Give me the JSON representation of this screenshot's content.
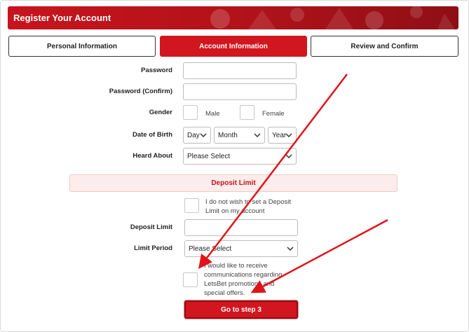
{
  "header": {
    "title": "Register Your Account"
  },
  "steps": [
    {
      "label": "Personal Information",
      "active": false
    },
    {
      "label": "Account Information",
      "active": true
    },
    {
      "label": "Review and Confirm",
      "active": false
    }
  ],
  "form": {
    "password_label": "Password",
    "password_confirm_label": "Password (Confirm)",
    "gender_label": "Gender",
    "gender_male": "Male",
    "gender_female": "Female",
    "dob_label": "Date of Birth",
    "dob_day": "Day",
    "dob_month": "Month",
    "dob_year": "Year",
    "heard_about_label": "Heard About",
    "heard_about_value": "Please Select"
  },
  "deposit": {
    "section_title": "Deposit Limit",
    "no_limit_text": "I do not wish to set a Deposit Limit on my account",
    "limit_label": "Deposit Limit",
    "period_label": "Limit Period",
    "period_value": "Please Select"
  },
  "promotions_text": "I would like to receive communications regarding LetsBet promotions and special offers.",
  "submit_label": "Go to step 3",
  "colors": {
    "brand_red": "#d2161f",
    "arrow_red": "#e0141c",
    "section_bg": "#fdecec"
  },
  "icons": {
    "chevron": "chevron-down-icon"
  }
}
